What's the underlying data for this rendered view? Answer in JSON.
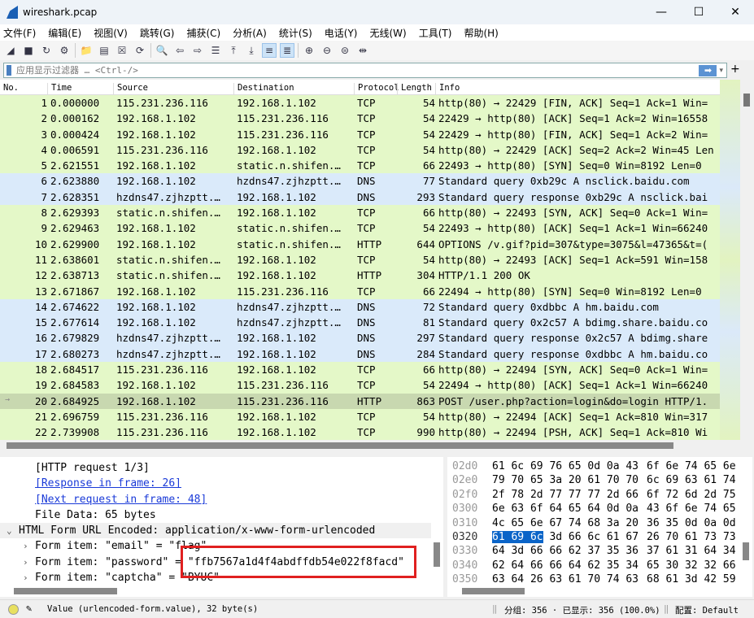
{
  "window": {
    "title": "wireshark.pcap",
    "min": "—",
    "max": "☐",
    "close": "✕"
  },
  "menu": [
    "文件(F)",
    "编辑(E)",
    "视图(V)",
    "跳转(G)",
    "捕获(C)",
    "分析(A)",
    "统计(S)",
    "电话(Y)",
    "无线(W)",
    "工具(T)",
    "帮助(H)"
  ],
  "toolbar": [
    "shark-fin-start",
    "stop",
    "restart",
    "options",
    "open",
    "file",
    "close-file",
    "reload",
    "find",
    "back",
    "forward",
    "go-to",
    "first",
    "last",
    "autoscroll",
    "colorize",
    "zoom-in",
    "zoom-out",
    "zoom-reset",
    "resize-columns"
  ],
  "filter": {
    "placeholder": "应用显示过滤器 … <Ctrl-/>",
    "apply": "➡",
    "plus": "+"
  },
  "columns": [
    "No.",
    "Time",
    "Source",
    "Destination",
    "Protocol",
    "Length",
    "Info"
  ],
  "colors": {
    "tcp": "#e4f8c8",
    "dns": "#daeafa",
    "selected": "#c8d8b0",
    "link": "#1a3ad8",
    "highlight": "#0a64c8",
    "redbox": "#e02020"
  },
  "packets": [
    {
      "no": "1",
      "time": "0.000000",
      "src": "115.231.236.116",
      "dst": "192.168.1.102",
      "proto": "TCP",
      "len": "54",
      "info": "http(80) → 22429 [FIN, ACK] Seq=1 Ack=1 Win="
    },
    {
      "no": "2",
      "time": "0.000162",
      "src": "192.168.1.102",
      "dst": "115.231.236.116",
      "proto": "TCP",
      "len": "54",
      "info": "22429 → http(80) [ACK] Seq=1 Ack=2 Win=16558"
    },
    {
      "no": "3",
      "time": "0.000424",
      "src": "192.168.1.102",
      "dst": "115.231.236.116",
      "proto": "TCP",
      "len": "54",
      "info": "22429 → http(80) [FIN, ACK] Seq=1 Ack=2 Win="
    },
    {
      "no": "4",
      "time": "0.006591",
      "src": "115.231.236.116",
      "dst": "192.168.1.102",
      "proto": "TCP",
      "len": "54",
      "info": "http(80) → 22429 [ACK] Seq=2 Ack=2 Win=45 Len"
    },
    {
      "no": "5",
      "time": "2.621551",
      "src": "192.168.1.102",
      "dst": "static.n.shifen.…",
      "proto": "TCP",
      "len": "66",
      "info": "22493 → http(80) [SYN] Seq=0 Win=8192 Len=0"
    },
    {
      "no": "6",
      "time": "2.623880",
      "src": "192.168.1.102",
      "dst": "hzdns47.zjhzptt.…",
      "proto": "DNS",
      "len": "77",
      "info": "Standard query 0xb29c A nsclick.baidu.com"
    },
    {
      "no": "7",
      "time": "2.628351",
      "src": "hzdns47.zjhzptt.…",
      "dst": "192.168.1.102",
      "proto": "DNS",
      "len": "293",
      "info": "Standard query response 0xb29c A nsclick.bai"
    },
    {
      "no": "8",
      "time": "2.629393",
      "src": "static.n.shifen.…",
      "dst": "192.168.1.102",
      "proto": "TCP",
      "len": "66",
      "info": "http(80) → 22493 [SYN, ACK] Seq=0 Ack=1 Win="
    },
    {
      "no": "9",
      "time": "2.629463",
      "src": "192.168.1.102",
      "dst": "static.n.shifen.…",
      "proto": "TCP",
      "len": "54",
      "info": "22493 → http(80) [ACK] Seq=1 Ack=1 Win=66240"
    },
    {
      "no": "10",
      "time": "2.629900",
      "src": "192.168.1.102",
      "dst": "static.n.shifen.…",
      "proto": "HTTP",
      "len": "644",
      "info": "OPTIONS /v.gif?pid=307&type=3075&l=47365&t=("
    },
    {
      "no": "11",
      "time": "2.638601",
      "src": "static.n.shifen.…",
      "dst": "192.168.1.102",
      "proto": "TCP",
      "len": "54",
      "info": "http(80) → 22493 [ACK] Seq=1 Ack=591 Win=158"
    },
    {
      "no": "12",
      "time": "2.638713",
      "src": "static.n.shifen.…",
      "dst": "192.168.1.102",
      "proto": "HTTP",
      "len": "304",
      "info": "HTTP/1.1 200 OK"
    },
    {
      "no": "13",
      "time": "2.671867",
      "src": "192.168.1.102",
      "dst": "115.231.236.116",
      "proto": "TCP",
      "len": "66",
      "info": "22494 → http(80) [SYN] Seq=0 Win=8192 Len=0"
    },
    {
      "no": "14",
      "time": "2.674622",
      "src": "192.168.1.102",
      "dst": "hzdns47.zjhzptt.…",
      "proto": "DNS",
      "len": "72",
      "info": "Standard query 0xdbbc A hm.baidu.com"
    },
    {
      "no": "15",
      "time": "2.677614",
      "src": "192.168.1.102",
      "dst": "hzdns47.zjhzptt.…",
      "proto": "DNS",
      "len": "81",
      "info": "Standard query 0x2c57 A bdimg.share.baidu.co"
    },
    {
      "no": "16",
      "time": "2.679829",
      "src": "hzdns47.zjhzptt.…",
      "dst": "192.168.1.102",
      "proto": "DNS",
      "len": "297",
      "info": "Standard query response 0x2c57 A bdimg.share"
    },
    {
      "no": "17",
      "time": "2.680273",
      "src": "hzdns47.zjhzptt.…",
      "dst": "192.168.1.102",
      "proto": "DNS",
      "len": "284",
      "info": "Standard query response 0xdbbc A hm.baidu.co"
    },
    {
      "no": "18",
      "time": "2.684517",
      "src": "115.231.236.116",
      "dst": "192.168.1.102",
      "proto": "TCP",
      "len": "66",
      "info": "http(80) → 22494 [SYN, ACK] Seq=0 Ack=1 Win="
    },
    {
      "no": "19",
      "time": "2.684583",
      "src": "192.168.1.102",
      "dst": "115.231.236.116",
      "proto": "TCP",
      "len": "54",
      "info": "22494 → http(80) [ACK] Seq=1 Ack=1 Win=66240"
    },
    {
      "no": "20",
      "time": "2.684925",
      "src": "192.168.1.102",
      "dst": "115.231.236.116",
      "proto": "HTTP",
      "len": "863",
      "info": "POST /user.php?action=login&do=login HTTP/1."
    },
    {
      "no": "21",
      "time": "2.696759",
      "src": "115.231.236.116",
      "dst": "192.168.1.102",
      "proto": "TCP",
      "len": "54",
      "info": "http(80) → 22494 [ACK] Seq=1 Ack=810 Win=317"
    },
    {
      "no": "22",
      "time": "2.739908",
      "src": "115.231.236.116",
      "dst": "192.168.1.102",
      "proto": "TCP",
      "len": "990",
      "info": "http(80) → 22494 [PSH, ACK] Seq=1 Ack=810 Wi"
    }
  ],
  "selected_packet": "20",
  "detail": [
    {
      "text": "[HTTP request 1/3]",
      "indent": 2,
      "link": false
    },
    {
      "text": "[Response in frame: 26]",
      "indent": 2,
      "link": true
    },
    {
      "text": "[Next request in frame: 48]",
      "indent": 2,
      "link": true
    },
    {
      "text": "File Data: 65 bytes",
      "indent": 2,
      "link": false
    },
    {
      "text": "HTML Form URL Encoded: application/x-www-form-urlencoded",
      "indent": 1,
      "link": false,
      "toggle": "⌄",
      "sel": true
    },
    {
      "text": "Form item: \"email\" = \"flag\"",
      "indent": 2,
      "link": false,
      "toggle": "›"
    },
    {
      "text": "Form item: \"password\" = \"ffb7567a1d4f4abdffdb54e022f8facd\"",
      "indent": 2,
      "link": false,
      "toggle": "›"
    },
    {
      "text": "Form item: \"captcha\" = \"BYUC\"",
      "indent": 2,
      "link": false,
      "toggle": "›"
    }
  ],
  "hex": [
    {
      "off": "02d0",
      "b1": "61 6c 69 76 65 0d 0a 43",
      "b2": "6f 6e 74 65 6e"
    },
    {
      "off": "02e0",
      "b1": "79 70 65 3a 20 61 70 70",
      "b2": "6c 69 63 61 74"
    },
    {
      "off": "02f0",
      "b1": "2f 78 2d 77 77 77 2d 66",
      "b2": "6f 72 6d 2d 75"
    },
    {
      "off": "0300",
      "b1": "6e 63 6f 64 65 64 0d 0a",
      "b2": "43 6f 6e 74 65"
    },
    {
      "off": "0310",
      "b1": "4c 65 6e 67 74 68 3a 20",
      "b2": "36 35 0d 0a 0d"
    },
    {
      "off": "0320",
      "hi": "61 69 6c",
      "b1": " 3d 66 6c 61 67",
      "b2": "26 70 61 73 73"
    },
    {
      "off": "0330",
      "b1": "64 3d 66 66 62 37 35 36",
      "b2": "37 61 31 64 34"
    },
    {
      "off": "0340",
      "b1": "62 64 66 66 64 62 35 34",
      "b2": "65 30 32 32 66"
    },
    {
      "off": "0350",
      "b1": "63 64 26 63 61 70 74 63",
      "b2": "68 61 3d 42 59"
    }
  ],
  "status": {
    "field": "Value (urlencoded-form.value), 32 byte(s)",
    "packets": "分组: 356 · 已显示: 356 (100.0%)",
    "profile": "配置: Default"
  }
}
